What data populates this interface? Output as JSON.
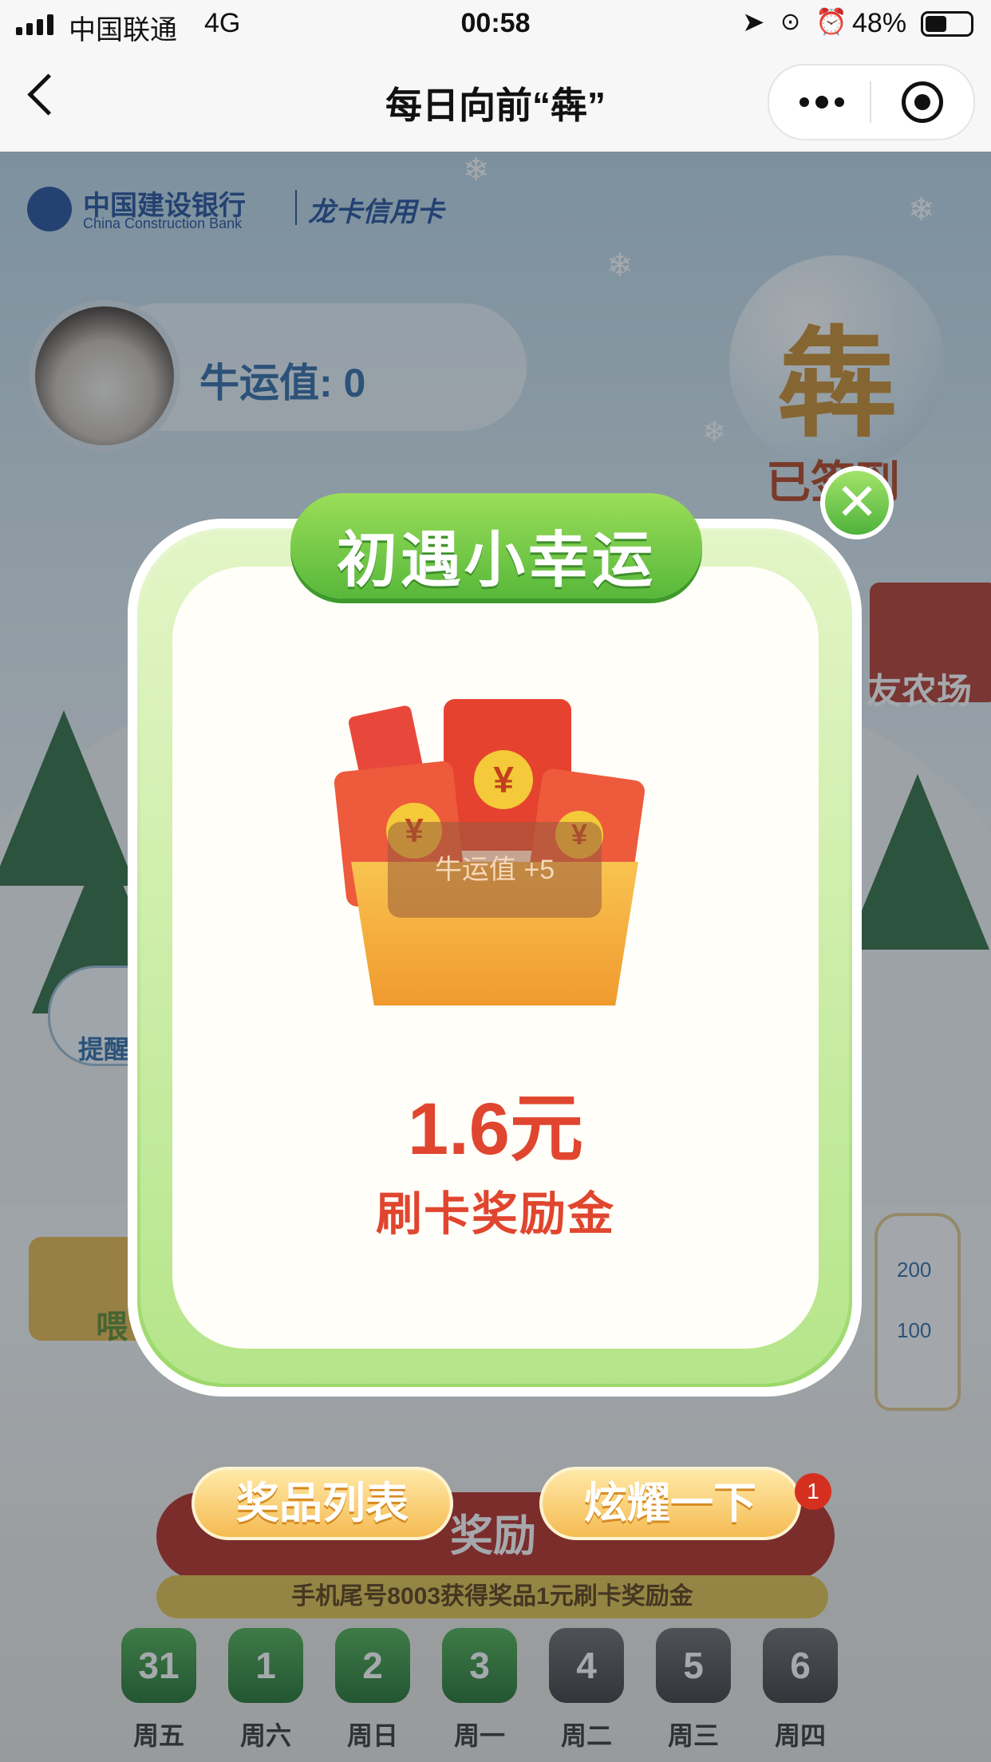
{
  "status_bar": {
    "carrier": "中国联通",
    "network": "4G",
    "time": "00:58",
    "battery": "48%"
  },
  "nav": {
    "title": "每日向前“犇”"
  },
  "brand": {
    "bank_cn": "中国建设银行",
    "bank_en": "China Construction Bank",
    "card": "龙卡信用卡"
  },
  "profile": {
    "luck_value_text": "牛运值: 0"
  },
  "badge": {
    "char": "犇",
    "status": "已签到"
  },
  "farm_link": "友农场",
  "remind_bubble": "提醒",
  "feed_label": "喂",
  "milk_bottle": {
    "mark_200": "200",
    "mark_100": "100"
  },
  "modal": {
    "title": "初遇小幸运",
    "bonus_text": "牛运值 +5",
    "amount": "1.6元",
    "amount_label": "刷卡奖励金"
  },
  "buttons": {
    "prize_list": "奖品列表",
    "center_partial": "奖励",
    "show_off": "炫耀一下",
    "notification_count": "1"
  },
  "ticker": "手机尾号8003获得奖品1元刷卡奖励金",
  "calendar": [
    {
      "day": "31",
      "weekday": "周五",
      "signed": true
    },
    {
      "day": "1",
      "weekday": "周六",
      "signed": true
    },
    {
      "day": "2",
      "weekday": "周日",
      "signed": true
    },
    {
      "day": "3",
      "weekday": "周一",
      "signed": true
    },
    {
      "day": "4",
      "weekday": "周二",
      "signed": false
    },
    {
      "day": "5",
      "weekday": "周三",
      "signed": false
    },
    {
      "day": "6",
      "weekday": "周四",
      "signed": false
    }
  ],
  "colors": {
    "accent_red": "#e0462f",
    "ribbon_green": "#58b83a",
    "button_gold": "#f5bb52"
  }
}
